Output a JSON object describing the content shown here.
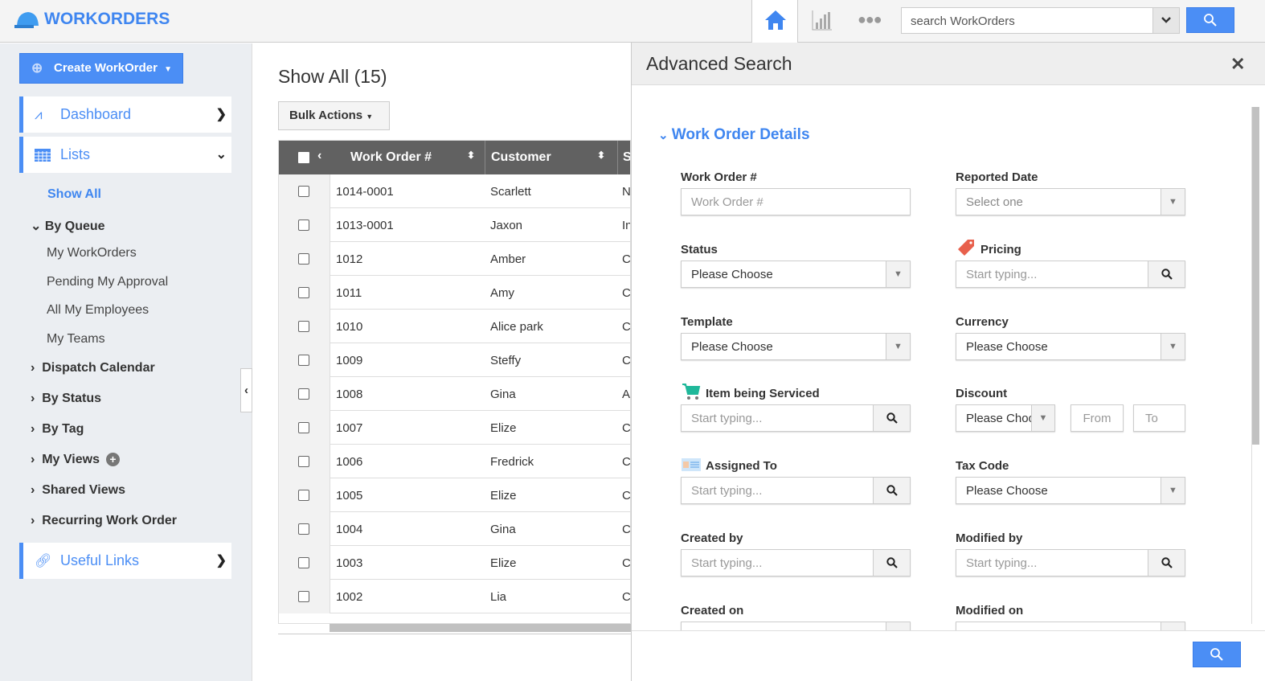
{
  "app": {
    "title": "WORKORDERS"
  },
  "topbar": {
    "search_placeholder": "search WorkOrders",
    "icons": [
      "home-icon",
      "bar-chart-icon",
      "more-dots-icon",
      "chevron-down-icon",
      "search-icon"
    ],
    "accent": "#4b8ef5"
  },
  "sidebar": {
    "create_label": "Create WorkOrder",
    "dashboard": "Dashboard",
    "lists": "Lists",
    "show_all": "Show All",
    "by_queue": "By Queue",
    "queue_items": [
      "My WorkOrders",
      "Pending My Approval",
      "All My Employees",
      "My Teams"
    ],
    "sections": [
      "Dispatch Calendar",
      "By Status",
      "By Tag",
      "My Views",
      "Shared Views",
      "Recurring Work Order"
    ],
    "useful_links": "Useful Links"
  },
  "main": {
    "title": "Show All (15)",
    "bulk_actions": "Bulk Actions",
    "columns": [
      "Work Order #",
      "Customer",
      "S"
    ],
    "rows": [
      [
        "1014-0001",
        "Scarlett",
        "N"
      ],
      [
        "1013-0001",
        "Jaxon",
        "In"
      ],
      [
        "1012",
        "Amber",
        "C"
      ],
      [
        "1011",
        "Amy",
        "C"
      ],
      [
        "1010",
        "Alice park",
        "C"
      ],
      [
        "1009",
        "Steffy",
        "C"
      ],
      [
        "1008",
        "Gina",
        "A"
      ],
      [
        "1007",
        "Elize",
        "C"
      ],
      [
        "1006",
        "Fredrick",
        "C"
      ],
      [
        "1005",
        "Elize",
        "C"
      ],
      [
        "1004",
        "Gina",
        "C"
      ],
      [
        "1003",
        "Elize",
        "C"
      ],
      [
        "1002",
        "Lia",
        "C"
      ]
    ]
  },
  "panel": {
    "title": "Advanced Search",
    "section": "Work Order Details",
    "fields": [
      {
        "label": "Work Order #",
        "type": "text",
        "placeholder": "Work Order #"
      },
      {
        "label": "Reported Date",
        "type": "select",
        "value": "Select one",
        "muted": true
      },
      {
        "label": "Status",
        "type": "select",
        "value": "Please Choose"
      },
      {
        "label": "Pricing",
        "type": "lookup",
        "placeholder": "Start typing...",
        "icon": "price-tag-icon"
      },
      {
        "label": "Template",
        "type": "select",
        "value": "Please Choose"
      },
      {
        "label": "Currency",
        "type": "select",
        "value": "Please Choose"
      },
      {
        "label": "Item being Serviced",
        "type": "lookup",
        "placeholder": "Start typing...",
        "icon": "cart-icon"
      },
      {
        "label": "Discount",
        "type": "discount",
        "value": "Please Choose",
        "from": "From",
        "to": "To"
      },
      {
        "label": "Assigned To",
        "type": "lookup",
        "placeholder": "Start typing...",
        "icon": "id-card-icon"
      },
      {
        "label": "Tax Code",
        "type": "select",
        "value": "Please Choose"
      },
      {
        "label": "Created by",
        "type": "lookup",
        "placeholder": "Start typing..."
      },
      {
        "label": "Modified by",
        "type": "lookup",
        "placeholder": "Start typing..."
      },
      {
        "label": "Created on",
        "type": "select",
        "value": ""
      },
      {
        "label": "Modified on",
        "type": "select",
        "value": ""
      }
    ]
  }
}
